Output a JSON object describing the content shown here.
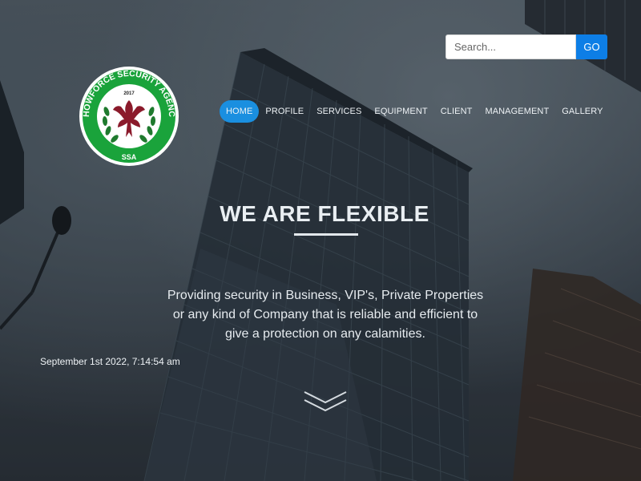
{
  "site": {
    "logo_text_top": "SHOWFORCE SECURITY AGENCY",
    "logo_year": "2017",
    "logo_text_bottom": "SSA"
  },
  "search": {
    "placeholder": "Search...",
    "value": "",
    "button_label": "GO"
  },
  "nav": {
    "items": [
      {
        "label": "HOME",
        "active": true
      },
      {
        "label": "PROFILE"
      },
      {
        "label": "SERVICES"
      },
      {
        "label": "EQUIPMENT"
      },
      {
        "label": "CLIENT"
      },
      {
        "label": "MANAGEMENT"
      },
      {
        "label": "GALLERY"
      }
    ]
  },
  "hero": {
    "title": "WE ARE FLEXIBLE",
    "text": "Providing security in Business, VIP's, Private Properties or any kind of Company that is reliable and efficient to give a protection on any calamities."
  },
  "datetime": "September 1st 2022, 7:14:54 am",
  "icons": {
    "scroll": "chevron-double-down-icon",
    "logo_emblem": "eagle-icon"
  },
  "colors": {
    "accent": "#1a8fe0",
    "button": "#0d7ee6",
    "logo_green": "#1aa33b",
    "logo_red": "#8b1a2b"
  }
}
